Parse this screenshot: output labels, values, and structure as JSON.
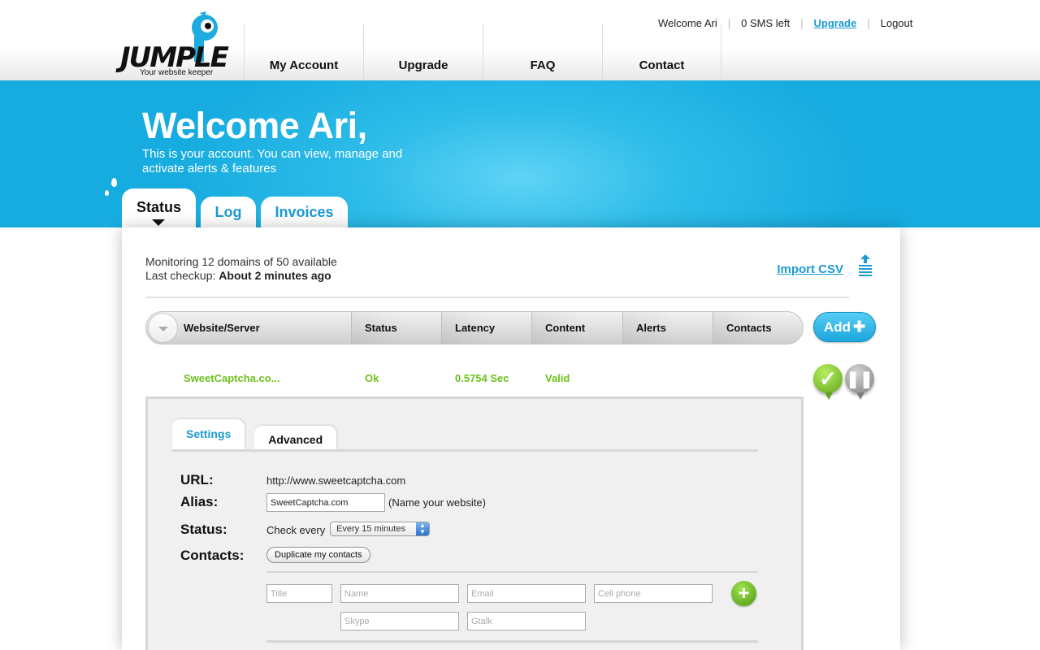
{
  "brand": {
    "logo_text": "JUMPLE",
    "tagline": "Your website keeper"
  },
  "topnav": [
    "My Account",
    "Upgrade",
    "FAQ",
    "Contact"
  ],
  "userbar": {
    "welcome": "Welcome Ari",
    "sms": "0 SMS left",
    "upgrade": "Upgrade",
    "logout": "Logout"
  },
  "banner": {
    "title": "Welcome Ari,",
    "subtitle": "This is your account. You can view, manage and activate alerts & features"
  },
  "tabs": [
    "Status",
    "Log",
    "Invoices"
  ],
  "summary": {
    "monitoring": "Monitoring 12 domains of 50 available",
    "last_prefix": "Last checkup: ",
    "last_value": "About 2 minutes ago"
  },
  "import_label": "Import CSV",
  "columns": [
    "Website/Server",
    "Status",
    "Latency",
    "Content",
    "Alerts",
    "Contacts"
  ],
  "add_label": "Add",
  "row": {
    "site": "SweetCaptcha.co...",
    "status": "Ok",
    "latency": "0.5754 Sec",
    "content": "Valid"
  },
  "detail": {
    "tabs": [
      "Settings",
      "Advanced"
    ],
    "url_label": "URL:",
    "url_value": "http://www.sweetcaptcha.com",
    "alias_label": "Alias:",
    "alias_value": "SweetCaptcha.com",
    "alias_hint": "(Name your website)",
    "status_label": "Status:",
    "check_prefix": "Check every",
    "interval": "Every 15 minutes",
    "contacts_label": "Contacts:",
    "duplicate_label": "Duplicate my contacts",
    "placeholders": {
      "title": "Title",
      "name": "Name",
      "email": "Email",
      "cell": "Cell phone",
      "skype": "Skype",
      "gtalk": "Gtalk"
    }
  },
  "colors": {
    "accent": "#1b9ad4",
    "banner": "#2fbde9",
    "ok_green": "#6cc11b"
  }
}
